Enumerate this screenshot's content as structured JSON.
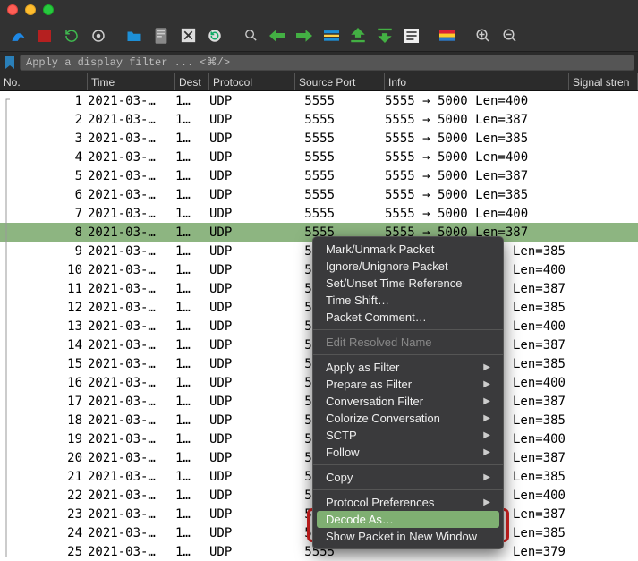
{
  "filter": {
    "placeholder": "Apply a display filter ... <⌘/>"
  },
  "columns": {
    "no": "No.",
    "time": "Time",
    "dest": "Dest",
    "proto": "Protocol",
    "sport": "Source Port",
    "info": "Info",
    "signal": "Signal stren"
  },
  "rows": [
    {
      "no": "1",
      "time": "2021-03-…",
      "dest": "1…",
      "proto": "UDP",
      "sport": "5555",
      "info": "5555 → 5000 Len=400"
    },
    {
      "no": "2",
      "time": "2021-03-…",
      "dest": "1…",
      "proto": "UDP",
      "sport": "5555",
      "info": "5555 → 5000 Len=387"
    },
    {
      "no": "3",
      "time": "2021-03-…",
      "dest": "1…",
      "proto": "UDP",
      "sport": "5555",
      "info": "5555 → 5000 Len=385"
    },
    {
      "no": "4",
      "time": "2021-03-…",
      "dest": "1…",
      "proto": "UDP",
      "sport": "5555",
      "info": "5555 → 5000 Len=400"
    },
    {
      "no": "5",
      "time": "2021-03-…",
      "dest": "1…",
      "proto": "UDP",
      "sport": "5555",
      "info": "5555 → 5000 Len=387"
    },
    {
      "no": "6",
      "time": "2021-03-…",
      "dest": "1…",
      "proto": "UDP",
      "sport": "5555",
      "info": "5555 → 5000 Len=385"
    },
    {
      "no": "7",
      "time": "2021-03-…",
      "dest": "1…",
      "proto": "UDP",
      "sport": "5555",
      "info": "5555 → 5000 Len=400"
    },
    {
      "no": "8",
      "time": "2021-03-…",
      "dest": "1…",
      "proto": "UDP",
      "sport": "5555",
      "info": "5555 → 5000 Len=387",
      "sel": true
    },
    {
      "no": "9",
      "time": "2021-03-…",
      "dest": "1…",
      "proto": "UDP",
      "sport": "5555",
      "info": "Len=385"
    },
    {
      "no": "10",
      "time": "2021-03-…",
      "dest": "1…",
      "proto": "UDP",
      "sport": "5555",
      "info": "Len=400"
    },
    {
      "no": "11",
      "time": "2021-03-…",
      "dest": "1…",
      "proto": "UDP",
      "sport": "5555",
      "info": "Len=387"
    },
    {
      "no": "12",
      "time": "2021-03-…",
      "dest": "1…",
      "proto": "UDP",
      "sport": "5555",
      "info": "Len=385"
    },
    {
      "no": "13",
      "time": "2021-03-…",
      "dest": "1…",
      "proto": "UDP",
      "sport": "5555",
      "info": "Len=400"
    },
    {
      "no": "14",
      "time": "2021-03-…",
      "dest": "1…",
      "proto": "UDP",
      "sport": "5555",
      "info": "Len=387"
    },
    {
      "no": "15",
      "time": "2021-03-…",
      "dest": "1…",
      "proto": "UDP",
      "sport": "5555",
      "info": "Len=385"
    },
    {
      "no": "16",
      "time": "2021-03-…",
      "dest": "1…",
      "proto": "UDP",
      "sport": "5555",
      "info": "Len=400"
    },
    {
      "no": "17",
      "time": "2021-03-…",
      "dest": "1…",
      "proto": "UDP",
      "sport": "5555",
      "info": "Len=387"
    },
    {
      "no": "18",
      "time": "2021-03-…",
      "dest": "1…",
      "proto": "UDP",
      "sport": "5555",
      "info": "Len=385"
    },
    {
      "no": "19",
      "time": "2021-03-…",
      "dest": "1…",
      "proto": "UDP",
      "sport": "5555",
      "info": "Len=400"
    },
    {
      "no": "20",
      "time": "2021-03-…",
      "dest": "1…",
      "proto": "UDP",
      "sport": "5555",
      "info": "Len=387"
    },
    {
      "no": "21",
      "time": "2021-03-…",
      "dest": "1…",
      "proto": "UDP",
      "sport": "5555",
      "info": "Len=385"
    },
    {
      "no": "22",
      "time": "2021-03-…",
      "dest": "1…",
      "proto": "UDP",
      "sport": "5555",
      "info": "Len=400"
    },
    {
      "no": "23",
      "time": "2021-03-…",
      "dest": "1…",
      "proto": "UDP",
      "sport": "5555",
      "info": "Len=387"
    },
    {
      "no": "24",
      "time": "2021-03-…",
      "dest": "1…",
      "proto": "UDP",
      "sport": "5555",
      "info": "Len=385"
    },
    {
      "no": "25",
      "time": "2021-03-…",
      "dest": "1…",
      "proto": "UDP",
      "sport": "5555",
      "info": "Len=379"
    }
  ],
  "menu": {
    "mark": "Mark/Unmark Packet",
    "ignore": "Ignore/Unignore Packet",
    "setref": "Set/Unset Time Reference",
    "timeshift": "Time Shift…",
    "comment": "Packet Comment…",
    "editname": "Edit Resolved Name",
    "applyfilter": "Apply as Filter",
    "preparefilter": "Prepare as Filter",
    "convfilter": "Conversation Filter",
    "colorize": "Colorize Conversation",
    "sctp": "SCTP",
    "follow": "Follow",
    "copy": "Copy",
    "protoprefs": "Protocol Preferences",
    "decode": "Decode As…",
    "shownew": "Show Packet in New Window"
  }
}
